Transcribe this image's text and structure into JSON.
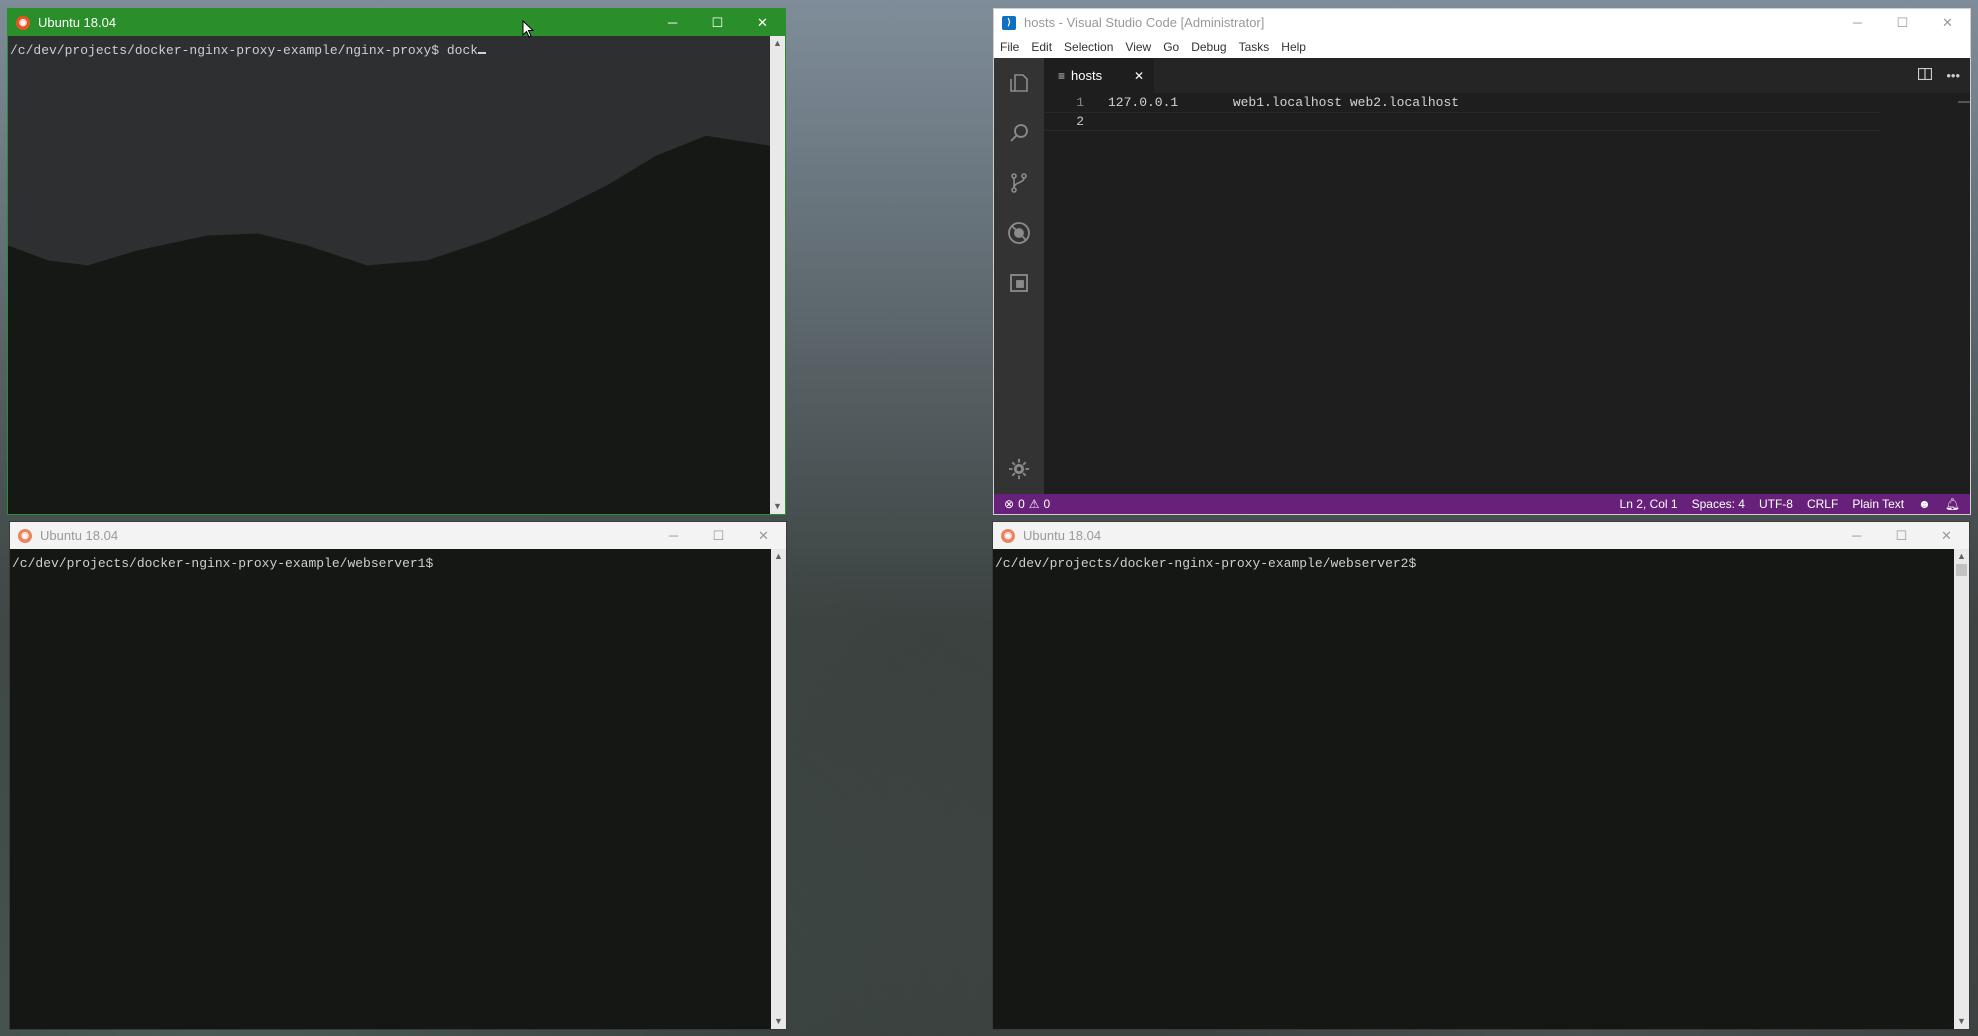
{
  "term1": {
    "title": "Ubuntu 18.04",
    "prompt": "/c/dev/projects/docker-nginx-proxy-example/nginx-proxy$ dock"
  },
  "term2": {
    "title": "Ubuntu 18.04",
    "prompt": "/c/dev/projects/docker-nginx-proxy-example/webserver1$"
  },
  "term3": {
    "title": "Ubuntu 18.04",
    "prompt": "/c/dev/projects/docker-nginx-proxy-example/webserver2$"
  },
  "window_controls": {
    "minimize": "─",
    "maximize": "☐",
    "close": "✕"
  },
  "vscode": {
    "title": "hosts - Visual Studio Code [Administrator]",
    "menu": [
      "File",
      "Edit",
      "Selection",
      "View",
      "Go",
      "Debug",
      "Tasks",
      "Help"
    ],
    "tab": {
      "label": "hosts",
      "close": "✕"
    },
    "lines": [
      {
        "num": "1",
        "text": "127.0.0.1       web1.localhost web2.localhost"
      },
      {
        "num": "2",
        "text": ""
      }
    ],
    "status": {
      "errors": "0",
      "warnings": "0",
      "position": "Ln 2, Col 1",
      "spaces": "Spaces: 4",
      "encoding": "UTF-8",
      "eol": "CRLF",
      "language": "Plain Text"
    },
    "colors": {
      "statusbar": "#68217a",
      "activitybar": "#333333"
    }
  },
  "colors": {
    "active_titlebar": "#2a8f2a",
    "ubuntu_icon": "#e95420"
  }
}
